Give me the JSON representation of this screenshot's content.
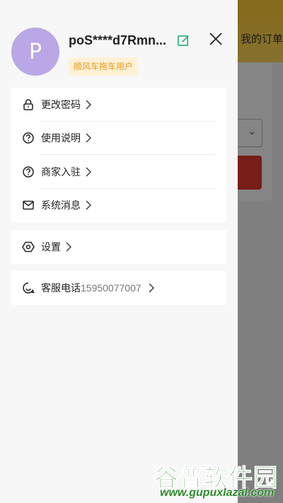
{
  "background": {
    "order_text": "我的订单",
    "accent_color": "#ffcc33",
    "button_color": "#e43a2f"
  },
  "drawer": {
    "avatar_letter": "P",
    "username": "poS****d7Rmn...",
    "user_badge": "顺风车拖车用户",
    "close_icon": "close-icon",
    "edit_icon": "edit-icon",
    "menu_group_1": [
      {
        "label": "更改密码",
        "icon": "lock-icon"
      },
      {
        "label": "使用说明",
        "icon": "help-circle-icon"
      },
      {
        "label": "商家入驻",
        "icon": "help-circle-icon"
      },
      {
        "label": "系统消息",
        "icon": "mail-icon"
      }
    ],
    "menu_group_2": [
      {
        "label": "设置",
        "icon": "settings-icon"
      }
    ],
    "menu_group_3": [
      {
        "label": "客服电话",
        "value": "15950077007",
        "icon": "customer-service-icon"
      }
    ]
  },
  "watermark": {
    "title": "谷普软件园",
    "url": "www.gupuxlazal.com"
  }
}
